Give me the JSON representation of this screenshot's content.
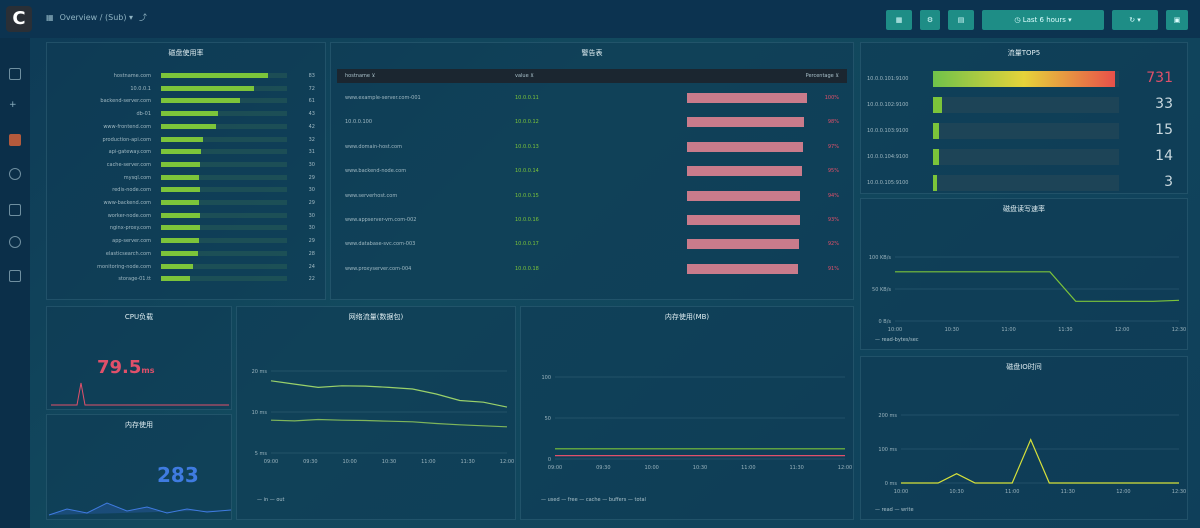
{
  "header": {
    "logo": "C",
    "breadcrumb": "Overview / (Sub) ▾",
    "share_icon": "⤴"
  },
  "toolbar": {
    "buttons": [
      {
        "label": "▦"
      },
      {
        "label": "⚙"
      },
      {
        "label": "▤"
      },
      {
        "label": "◷ Last 6 hours ▾"
      },
      {
        "label": "↻ ▾"
      },
      {
        "label": "▣"
      }
    ]
  },
  "sidebar": {
    "items": [
      "home",
      "search",
      "dashboards",
      "explore",
      "alerting",
      "config",
      "shield"
    ]
  },
  "panel1": {
    "title": "磁盘使用率",
    "items": [
      {
        "label": "hostname.com",
        "value": 0.85,
        "num": "83"
      },
      {
        "label": "10.0.0.1",
        "value": 0.74,
        "num": "72"
      },
      {
        "label": "backend-server.com",
        "value": 0.63,
        "num": "61"
      },
      {
        "label": "db-01",
        "value": 0.45,
        "num": "43"
      },
      {
        "label": "www-frontend.com",
        "value": 0.44,
        "num": "42"
      },
      {
        "label": "production-api.com",
        "value": 0.33,
        "num": "32"
      },
      {
        "label": "api-gateway.com",
        "value": 0.32,
        "num": "31"
      },
      {
        "label": "cache-server.com",
        "value": 0.31,
        "num": "30"
      },
      {
        "label": "mysql.com",
        "value": 0.3,
        "num": "29"
      },
      {
        "label": "redis-node.com",
        "value": 0.31,
        "num": "30"
      },
      {
        "label": "www-backend.com",
        "value": 0.3,
        "num": "29"
      },
      {
        "label": "worker-node.com",
        "value": 0.31,
        "num": "30"
      },
      {
        "label": "nginx-proxy.com",
        "value": 0.31,
        "num": "30"
      },
      {
        "label": "app-server.com",
        "value": 0.3,
        "num": "29"
      },
      {
        "label": "elasticsearch.com",
        "value": 0.29,
        "num": "28"
      },
      {
        "label": "monitoring-node.com",
        "value": 0.25,
        "num": "24"
      },
      {
        "label": "storage-01.tt",
        "value": 0.23,
        "num": "22"
      }
    ]
  },
  "panel2": {
    "title": "警告表",
    "headers": [
      "hostname ⊻",
      "value ⊻",
      "Percentage ⊻"
    ],
    "rows": [
      {
        "host": "www.example-server.com-001",
        "ip": "10.0.0.11",
        "pct": "100%",
        "fill": 0.95
      },
      {
        "host": "10.0.0.100",
        "ip": "10.0.0.12",
        "pct": "98%",
        "fill": 0.93
      },
      {
        "host": "www.domain-host.com",
        "ip": "10.0.0.13",
        "pct": "97%",
        "fill": 0.92
      },
      {
        "host": "www.backend-node.com",
        "ip": "10.0.0.14",
        "pct": "95%",
        "fill": 0.91
      },
      {
        "host": "www.serverhost.com",
        "ip": "10.0.0.15",
        "pct": "94%",
        "fill": 0.9
      },
      {
        "host": "www.appserver-vm.com-002",
        "ip": "10.0.0.16",
        "pct": "93%",
        "fill": 0.9
      },
      {
        "host": "www.database-svc.com-003",
        "ip": "10.0.0.17",
        "pct": "92%",
        "fill": 0.89
      },
      {
        "host": "www.proxyserver.com-004",
        "ip": "10.0.0.18",
        "pct": "91%",
        "fill": 0.88
      }
    ]
  },
  "panel3": {
    "title": "流量TOP5",
    "items": [
      {
        "label": "10.0.0.101:9100",
        "fill": 0.98,
        "value": "731"
      },
      {
        "label": "10.0.0.102:9100",
        "fill": 0.05,
        "value": "33"
      },
      {
        "label": "10.0.0.103:9100",
        "fill": 0.03,
        "value": "15"
      },
      {
        "label": "10.0.0.104:9100",
        "fill": 0.03,
        "value": "14"
      },
      {
        "label": "10.0.0.105:9100",
        "fill": 0.02,
        "value": "3"
      }
    ]
  },
  "panel4": {
    "title": "CPU负载",
    "value": "79.5",
    "unit": "ms"
  },
  "panel5": {
    "title": "内存使用",
    "value": "283"
  },
  "panel6": {
    "title": "网络流量(数据包)",
    "y_ticks": [
      "20 ms",
      "10 ms",
      "5 ms"
    ],
    "x_ticks": [
      "09:00",
      "09:30",
      "10:00",
      "10:30",
      "11:00",
      "11:30",
      "12:00"
    ],
    "legend": "— in  — out",
    "chart_data": {
      "type": "line",
      "series": [
        {
          "values": [
            22,
            21,
            20,
            20.5,
            20.4,
            20,
            19.5,
            18,
            16,
            15.5,
            14
          ]
        },
        {
          "values": [
            10,
            9.8,
            10.2,
            10,
            9.9,
            9.7,
            9.5,
            9,
            8.6,
            8.3,
            8
          ]
        }
      ],
      "ylim": [
        0,
        25
      ]
    }
  },
  "panel7": {
    "title": "内存使用(MB)",
    "y_ticks": [
      "100",
      "50",
      "0"
    ],
    "x_ticks": [
      "09:00",
      "09:30",
      "10:00",
      "10:30",
      "11:00",
      "11:30",
      "12:00"
    ],
    "legend": "— used   — free — cache   — buffers — total",
    "chart_data": {
      "type": "line",
      "series": [
        {
          "values": [
            5,
            5,
            5,
            5,
            5,
            5,
            5,
            5,
            5,
            5,
            5
          ]
        },
        {
          "values": [
            15,
            15,
            15,
            15,
            15,
            15,
            15,
            15,
            15,
            15,
            15
          ]
        }
      ],
      "ylim": [
        0,
        120
      ]
    }
  },
  "panel8": {
    "title": "磁盘读写速率",
    "y_ticks": [
      "100 KB/s",
      "50 KB/s",
      "0 B/s"
    ],
    "x_ticks": [
      "10:00",
      "10:30",
      "11:00",
      "11:30",
      "12:00",
      "12:30"
    ],
    "legend": "— read-bytes/sec",
    "chart_data": {
      "type": "line",
      "series": [
        {
          "values": [
            100,
            100,
            100,
            100,
            100,
            100,
            100,
            40,
            40,
            40,
            40,
            42
          ]
        }
      ],
      "ylim": [
        0,
        130
      ]
    }
  },
  "panel9": {
    "title": "磁盘IO时间",
    "y_ticks": [
      "200 ms",
      "100 ms",
      "0 ms"
    ],
    "x_ticks": [
      "10:00",
      "10:30",
      "11:00",
      "11:30",
      "12:00",
      "12:30"
    ],
    "legend": "— read  — write",
    "chart_data": {
      "type": "line",
      "series": [
        {
          "values": [
            0,
            0,
            0,
            30,
            0,
            0,
            0,
            140,
            0,
            0,
            0,
            0,
            0,
            0,
            0,
            0
          ]
        }
      ],
      "ylim": [
        0,
        220
      ]
    }
  }
}
